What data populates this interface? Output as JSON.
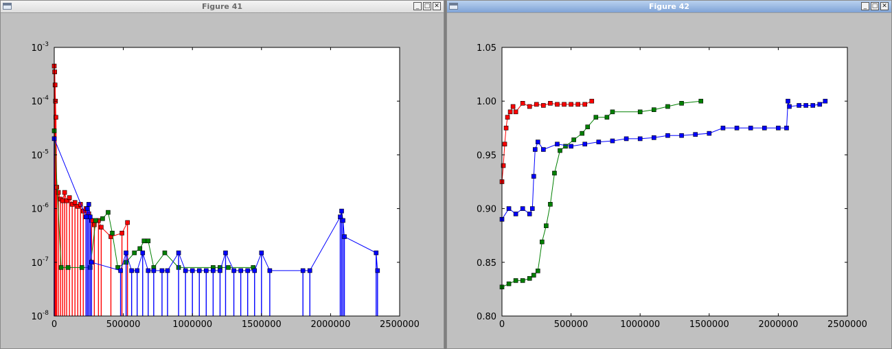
{
  "windows": [
    {
      "title": "Figure 41"
    },
    {
      "title": "Figure 42"
    }
  ],
  "window_buttons": {
    "minimize": "_",
    "maximize": "□",
    "close": "✕"
  },
  "icons": {
    "app": "window-icon",
    "minimize": "minimize-icon",
    "maximize": "maximize-icon",
    "close": "close-icon"
  },
  "chart_data": [
    {
      "type": "scatter",
      "title": "",
      "xlabel": "",
      "ylabel": "",
      "xlim": [
        0,
        2500000
      ],
      "ylim": [
        1e-08,
        0.001
      ],
      "yscale": "log",
      "grid": false,
      "x_ticks": [
        0,
        500000,
        1000000,
        1500000,
        2000000,
        2500000
      ],
      "x_tick_labels": [
        "0",
        "500000",
        "1000000",
        "1500000",
        "2000000",
        "2500000"
      ],
      "y_ticks": [
        1e-08,
        1e-07,
        1e-06,
        1e-05,
        0.0001,
        0.001
      ],
      "y_tick_labels": [
        {
          "base": "10",
          "exp": "-8"
        },
        {
          "base": "10",
          "exp": "-7"
        },
        {
          "base": "10",
          "exp": "-6"
        },
        {
          "base": "10",
          "exp": "-5"
        },
        {
          "base": "10",
          "exp": "-4"
        },
        {
          "base": "10",
          "exp": "-3"
        }
      ],
      "series": [
        {
          "color": "#ff0000",
          "linestyle": "solid",
          "marker": "square",
          "drop": true,
          "points": [
            [
              0,
              0.00045
            ],
            [
              3000,
              0.00035
            ],
            [
              6000,
              0.0002
            ],
            [
              9000,
              0.0001
            ],
            [
              12000,
              5e-05
            ],
            [
              18000,
              2.5e-06
            ],
            [
              30000,
              2e-06
            ],
            [
              45000,
              1.5e-06
            ],
            [
              60000,
              1.4e-06
            ],
            [
              75000,
              2e-06
            ],
            [
              90000,
              1.4e-06
            ],
            [
              110000,
              1.6e-06
            ],
            [
              130000,
              1.2e-06
            ],
            [
              150000,
              1.3e-06
            ],
            [
              170000,
              1.1e-06
            ],
            [
              190000,
              1.2e-06
            ],
            [
              210000,
              9e-07
            ],
            [
              230000,
              1e-06
            ],
            [
              250000,
              8e-07
            ],
            [
              270000,
              6e-07
            ],
            [
              290000,
              5e-07
            ],
            [
              320000,
              6e-07
            ],
            [
              340000,
              4.5e-07
            ],
            [
              410000,
              3e-07
            ],
            [
              490000,
              3.5e-07
            ],
            [
              530000,
              5.5e-07
            ]
          ]
        },
        {
          "color": "#008000",
          "linestyle": "solid",
          "marker": "square",
          "drop": false,
          "points": [
            [
              0,
              2.8e-05
            ],
            [
              50000,
              8e-08
            ],
            [
              100000,
              8e-08
            ],
            [
              200000,
              8e-08
            ],
            [
              260000,
              8e-08
            ],
            [
              300000,
              6e-07
            ],
            [
              350000,
              6.5e-07
            ],
            [
              390000,
              8.5e-07
            ],
            [
              420000,
              3.5e-07
            ],
            [
              460000,
              8e-08
            ],
            [
              520000,
              1e-07
            ],
            [
              580000,
              1.5e-07
            ],
            [
              620000,
              1.8e-07
            ],
            [
              650000,
              2.5e-07
            ],
            [
              680000,
              2.5e-07
            ],
            [
              720000,
              8e-08
            ],
            [
              800000,
              1.5e-07
            ],
            [
              900000,
              8e-08
            ],
            [
              1150000,
              8e-08
            ],
            [
              1200000,
              8e-08
            ],
            [
              1260000,
              8e-08
            ],
            [
              1440000,
              8e-08
            ]
          ]
        },
        {
          "color": "#0000ff",
          "linestyle": "solid",
          "marker": "square",
          "drop": true,
          "points": [
            [
              0,
              2e-05
            ],
            [
              230000,
              7e-07
            ],
            [
              240000,
              1e-06
            ],
            [
              250000,
              1.2e-06
            ],
            [
              260000,
              7e-07
            ],
            [
              270000,
              1e-07
            ],
            [
              480000,
              7e-08
            ],
            [
              520000,
              1.5e-07
            ],
            [
              560000,
              7e-08
            ],
            [
              600000,
              7e-08
            ],
            [
              640000,
              1.5e-07
            ],
            [
              680000,
              7e-08
            ],
            [
              720000,
              7e-08
            ],
            [
              780000,
              7e-08
            ],
            [
              820000,
              7e-08
            ],
            [
              900000,
              1.5e-07
            ],
            [
              950000,
              7e-08
            ],
            [
              1000000,
              7e-08
            ],
            [
              1050000,
              7e-08
            ],
            [
              1100000,
              7e-08
            ],
            [
              1150000,
              7e-08
            ],
            [
              1200000,
              7e-08
            ],
            [
              1240000,
              1.5e-07
            ],
            [
              1300000,
              7e-08
            ],
            [
              1350000,
              7e-08
            ],
            [
              1400000,
              7e-08
            ],
            [
              1450000,
              7e-08
            ],
            [
              1500000,
              1.5e-07
            ],
            [
              1560000,
              7e-08
            ],
            [
              1800000,
              7e-08
            ],
            [
              1850000,
              7e-08
            ],
            [
              2070000,
              7e-07
            ],
            [
              2080000,
              9e-07
            ],
            [
              2090000,
              6e-07
            ],
            [
              2100000,
              3e-07
            ],
            [
              2330000,
              1.5e-07
            ],
            [
              2340000,
              7e-08
            ]
          ]
        }
      ]
    },
    {
      "type": "line",
      "title": "",
      "xlabel": "",
      "ylabel": "",
      "xlim": [
        0,
        2500000
      ],
      "ylim": [
        0.8,
        1.05
      ],
      "grid": false,
      "x_ticks": [
        0,
        500000,
        1000000,
        1500000,
        2000000,
        2500000
      ],
      "x_tick_labels": [
        "0",
        "500000",
        "1000000",
        "1500000",
        "2000000",
        "2500000"
      ],
      "y_ticks": [
        0.8,
        0.85,
        0.9,
        0.95,
        1.0,
        1.05
      ],
      "y_tick_labels": [
        "0.80",
        "0.85",
        "0.90",
        "0.95",
        "1.00",
        "1.05"
      ],
      "series": [
        {
          "color": "#ff0000",
          "linestyle": "solid",
          "marker": "square",
          "points": [
            [
              0,
              0.925
            ],
            [
              10000,
              0.94
            ],
            [
              20000,
              0.96
            ],
            [
              30000,
              0.975
            ],
            [
              40000,
              0.985
            ],
            [
              60000,
              0.99
            ],
            [
              80000,
              0.995
            ],
            [
              100000,
              0.99
            ],
            [
              150000,
              0.998
            ],
            [
              200000,
              0.995
            ],
            [
              250000,
              0.997
            ],
            [
              300000,
              0.996
            ],
            [
              350000,
              0.998
            ],
            [
              400000,
              0.997
            ],
            [
              450000,
              0.997
            ],
            [
              500000,
              0.997
            ],
            [
              550000,
              0.997
            ],
            [
              600000,
              0.997
            ],
            [
              650000,
              1.0
            ]
          ]
        },
        {
          "color": "#008000",
          "linestyle": "solid",
          "marker": "square",
          "points": [
            [
              0,
              0.827
            ],
            [
              50000,
              0.83
            ],
            [
              100000,
              0.833
            ],
            [
              150000,
              0.833
            ],
            [
              200000,
              0.835
            ],
            [
              230000,
              0.838
            ],
            [
              260000,
              0.842
            ],
            [
              290000,
              0.869
            ],
            [
              320000,
              0.884
            ],
            [
              350000,
              0.904
            ],
            [
              380000,
              0.933
            ],
            [
              420000,
              0.954
            ],
            [
              460000,
              0.958
            ],
            [
              520000,
              0.964
            ],
            [
              580000,
              0.97
            ],
            [
              620000,
              0.976
            ],
            [
              680000,
              0.985
            ],
            [
              760000,
              0.985
            ],
            [
              800000,
              0.99
            ],
            [
              1000000,
              0.99
            ],
            [
              1100000,
              0.992
            ],
            [
              1200000,
              0.995
            ],
            [
              1300000,
              0.998
            ],
            [
              1440000,
              1.0
            ]
          ]
        },
        {
          "color": "#0000ff",
          "linestyle": "solid",
          "marker": "square",
          "points": [
            [
              0,
              0.89
            ],
            [
              50000,
              0.9
            ],
            [
              100000,
              0.895
            ],
            [
              150000,
              0.9
            ],
            [
              200000,
              0.895
            ],
            [
              220000,
              0.9
            ],
            [
              230000,
              0.93
            ],
            [
              240000,
              0.955
            ],
            [
              260000,
              0.962
            ],
            [
              300000,
              0.955
            ],
            [
              400000,
              0.96
            ],
            [
              500000,
              0.958
            ],
            [
              600000,
              0.96
            ],
            [
              700000,
              0.962
            ],
            [
              800000,
              0.963
            ],
            [
              900000,
              0.965
            ],
            [
              1000000,
              0.965
            ],
            [
              1100000,
              0.966
            ],
            [
              1200000,
              0.968
            ],
            [
              1300000,
              0.968
            ],
            [
              1400000,
              0.969
            ],
            [
              1500000,
              0.97
            ],
            [
              1600000,
              0.975
            ],
            [
              1700000,
              0.975
            ],
            [
              1800000,
              0.975
            ],
            [
              1900000,
              0.975
            ],
            [
              2000000,
              0.975
            ],
            [
              2060000,
              0.975
            ],
            [
              2070000,
              1.0
            ],
            [
              2080000,
              0.995
            ],
            [
              2150000,
              0.996
            ],
            [
              2200000,
              0.996
            ],
            [
              2250000,
              0.996
            ],
            [
              2300000,
              0.997
            ],
            [
              2340000,
              1.0
            ]
          ]
        }
      ]
    }
  ]
}
